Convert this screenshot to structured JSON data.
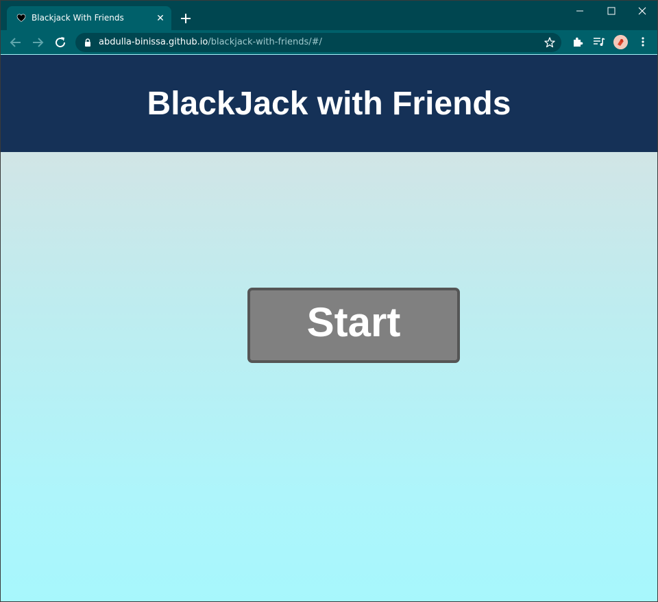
{
  "browser": {
    "tab": {
      "title": "Blackjack With Friends",
      "close_glyph": "✕",
      "favicon": "heart-icon"
    },
    "new_tab_icon": "plus-icon",
    "window_controls": [
      "minimize-icon",
      "maximize-icon",
      "close-icon"
    ],
    "address": {
      "host": "abdulla-binissa.github.io",
      "path": "/blackjack-with-friends/#/"
    },
    "toolbar_icons": [
      "back-icon",
      "forward-icon",
      "reload-icon",
      "lock-icon",
      "star-icon",
      "extensions-icon",
      "media-icon",
      "menu-icon"
    ],
    "colors": {
      "tabstrip": "#004650",
      "active_tab": "#00606a",
      "omnibox": "#004650"
    }
  },
  "page": {
    "title": "BlackJack with Friends",
    "start_label": "Start",
    "colors": {
      "header": "#153157",
      "button_fill": "#808080",
      "button_border": "#555555",
      "gradient_top": "#d8dfe2",
      "gradient_bottom": "#a7f7fc"
    }
  }
}
